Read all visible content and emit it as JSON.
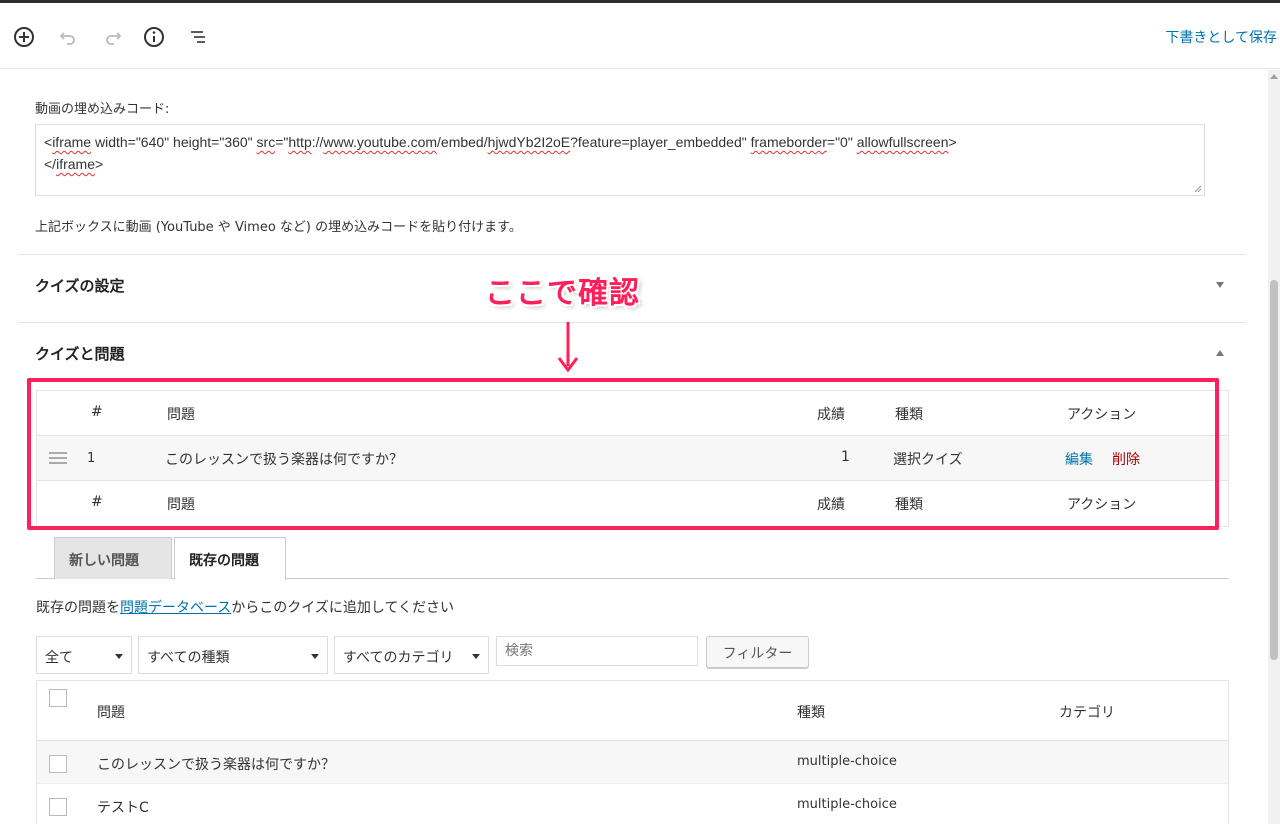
{
  "toolbar": {
    "icons": [
      "add-block-icon",
      "undo-icon",
      "redo-icon",
      "info-icon",
      "outline-icon"
    ],
    "save_draft": "下書きとして保存"
  },
  "embed": {
    "label": "動画の埋め込みコード:",
    "code_line1_parts": [
      "<",
      "iframe",
      " width=\"640\" height=\"360\" ",
      "src",
      "=\"",
      "http",
      "://",
      "www.youtube.com",
      "/embed/",
      "hjwdYb2I2oE",
      "?feature=player_embedded\" ",
      "frameborder",
      "=\"0\" ",
      "allowfullscreen",
      ">"
    ],
    "code_line2_parts": [
      "</",
      "iframe",
      ">"
    ],
    "help": "上記ボックスに動画 (YouTube や Vimeo など) の埋め込みコードを貼り付けます。"
  },
  "sections": {
    "quiz_settings": "クイズの設定",
    "quiz_questions": "クイズと問題"
  },
  "annotation": {
    "text": "ここで確認",
    "color": "#ff1f5a"
  },
  "questions_table": {
    "headers": {
      "num": "#",
      "question": "問題",
      "grade": "成績",
      "type": "種類",
      "action": "アクション"
    },
    "rows": [
      {
        "num": "1",
        "question": "このレッスンで扱う楽器は何ですか？",
        "grade": "1",
        "type": "選択クイズ",
        "edit": "編集",
        "delete": "削除"
      }
    ]
  },
  "tabs": {
    "new": "新しい問題",
    "existing": "既存の問題"
  },
  "existing": {
    "help_before": "既存の問題を",
    "help_link": "問題データベース",
    "help_after": "からこのクイズに追加してください",
    "filters": {
      "scope": "全て",
      "type": "すべての種類",
      "category": "すべてのカテゴリ",
      "search_placeholder": "検索",
      "button": "フィルター"
    },
    "headers": {
      "question": "問題",
      "type": "種類",
      "category": "カテゴリ"
    },
    "rows": [
      {
        "question": "このレッスンで扱う楽器は何ですか？",
        "type": "multiple-choice"
      },
      {
        "question": "テストC",
        "type": "multiple-choice"
      }
    ]
  },
  "colors": {
    "link": "#0073aa",
    "delete": "#aa0000",
    "accent": "#ff1f5a"
  }
}
